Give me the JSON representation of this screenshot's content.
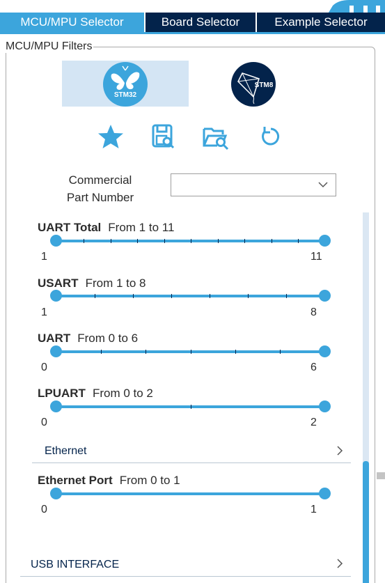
{
  "tabs": [
    {
      "label": "MCU/MPU Selector",
      "active": true
    },
    {
      "label": "Board Selector",
      "active": false
    },
    {
      "label": "Example Selector",
      "active": false
    }
  ],
  "filters_panel": {
    "legend": "MCU/MPU Filters",
    "families": [
      {
        "icon": "stm32-butterfly-logo-icon",
        "label": "STM32",
        "selected": true
      },
      {
        "icon": "stm8-kite-logo-icon",
        "label": "STM8",
        "selected": false
      }
    ],
    "toolbar": [
      {
        "icon": "star-icon"
      },
      {
        "icon": "save-search-icon"
      },
      {
        "icon": "open-folder-search-icon"
      },
      {
        "icon": "reset-icon"
      }
    ],
    "commercial_part_number": {
      "label_line1": "Commercial",
      "label_line2": "Part Number",
      "value": ""
    },
    "sliders": [
      {
        "name": "UART Total",
        "range": "From 1 to 11",
        "min": "1",
        "max": "11"
      },
      {
        "name": "USART",
        "range": "From 1 to 8",
        "min": "1",
        "max": "8"
      },
      {
        "name": "UART",
        "range": "From 0 to 6",
        "min": "0",
        "max": "6"
      },
      {
        "name": "LPUART",
        "range": "From 0 to 2",
        "min": "0",
        "max": "2"
      }
    ],
    "ethernet_section": {
      "label": "Ethernet"
    },
    "ethernet_slider": {
      "name": "Ethernet Port",
      "range": "From 0 to 1",
      "min": "0",
      "max": "1"
    },
    "usb_section": {
      "label": "USB INTERFACE"
    }
  },
  "colors": {
    "accent": "#3ca5dc",
    "navy": "#03234b",
    "selected_bg": "#d4e5f4"
  }
}
